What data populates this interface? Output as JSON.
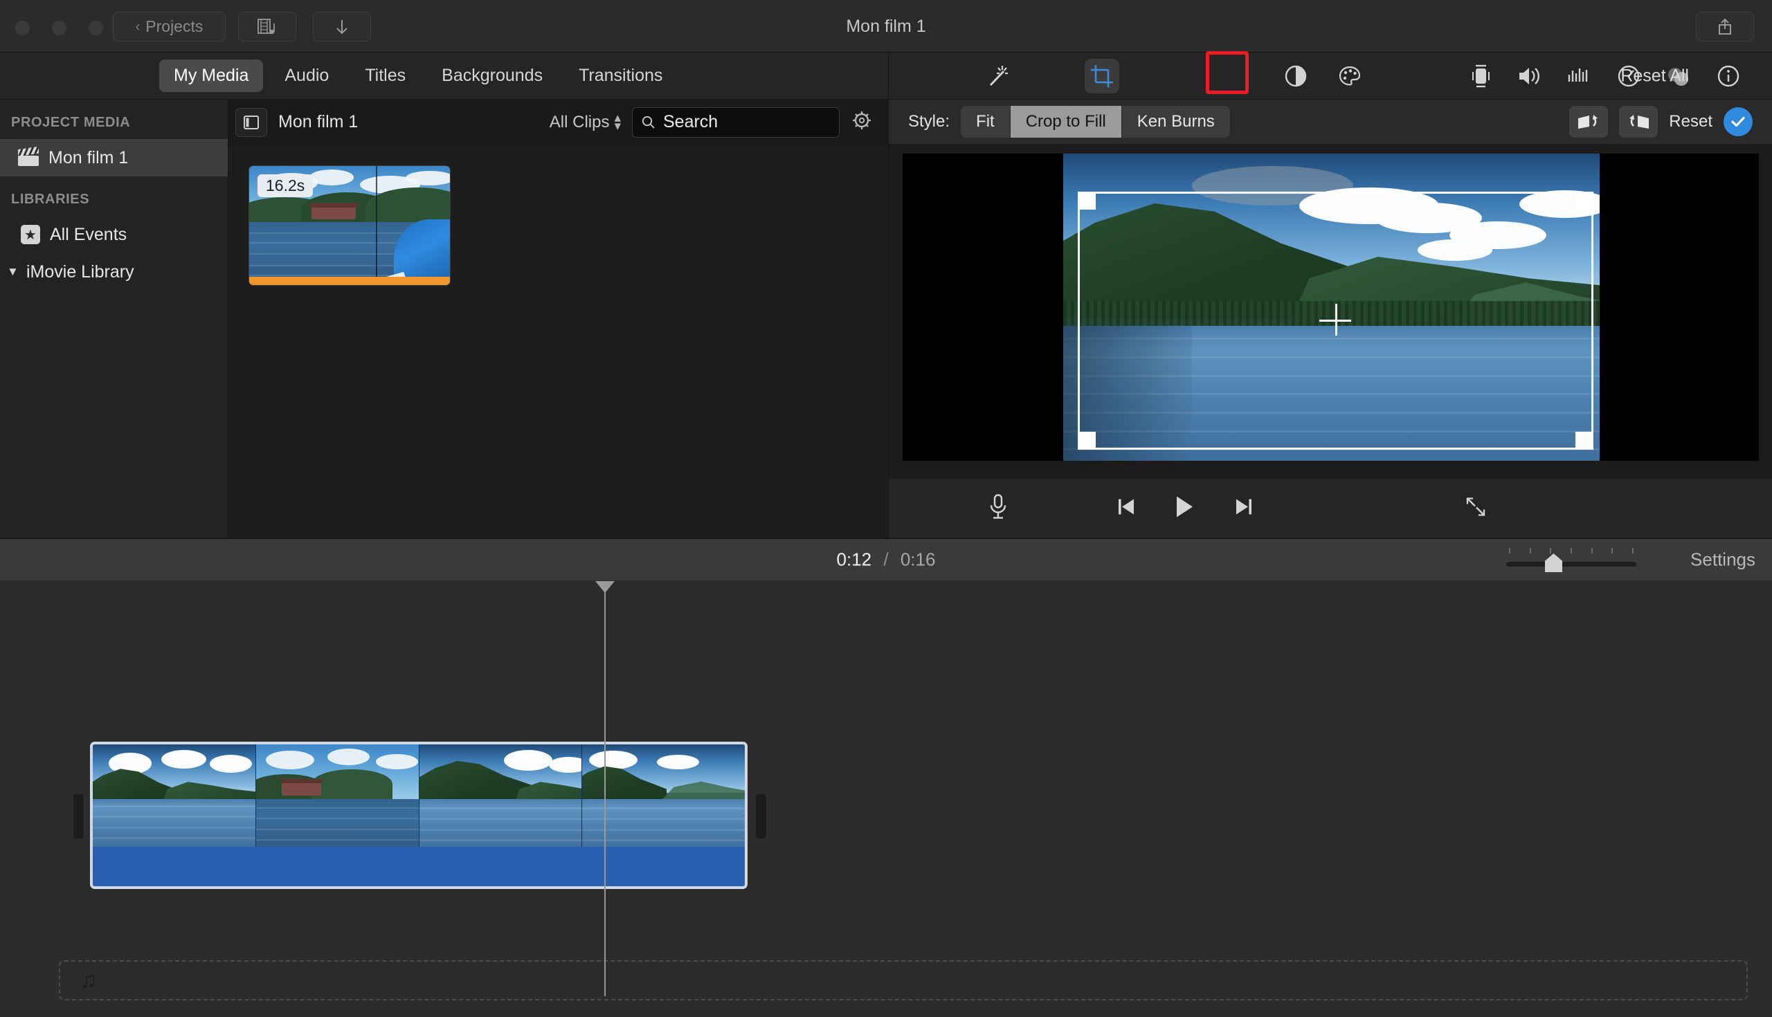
{
  "window": {
    "title": "Mon film 1",
    "traffic_lights": [
      "close",
      "minimize",
      "zoom"
    ],
    "projects_button": "Projects",
    "media_button_icon": "film-music-icon",
    "import_button_icon": "download-arrow-icon",
    "share_button_icon": "share-icon"
  },
  "tabs": [
    {
      "label": "My Media",
      "active": true
    },
    {
      "label": "Audio",
      "active": false
    },
    {
      "label": "Titles",
      "active": false
    },
    {
      "label": "Backgrounds",
      "active": false
    },
    {
      "label": "Transitions",
      "active": false
    }
  ],
  "sidebar": {
    "project_media_header": "PROJECT MEDIA",
    "project_item": {
      "label": "Mon film 1",
      "icon": "clapperboard-icon",
      "selected": true
    },
    "libraries_header": "LIBRARIES",
    "all_events": {
      "label": "All Events",
      "icon": "star-icon"
    },
    "imovie_library": {
      "label": "iMovie Library",
      "icon": "disclosure-triangle-icon",
      "expanded": true
    }
  },
  "browser": {
    "panel_toggle_icon": "sidebar-toggle-icon",
    "title": "Mon film 1",
    "filter_label": "All Clips",
    "filter_icon": "up-down-chevron-icon",
    "search_placeholder": "Search",
    "search_icon": "search-icon",
    "settings_icon": "gear-icon",
    "clips": [
      {
        "duration": "16.2s",
        "selected": true
      }
    ]
  },
  "inspector": {
    "tools": [
      {
        "name": "magic-wand-icon",
        "active": false
      },
      {
        "name": "color-balance-icon",
        "active": false
      },
      {
        "name": "color-correction-icon",
        "active": false
      },
      {
        "name": "crop-icon",
        "active": true,
        "highlighted": true
      },
      {
        "name": "stabilization-icon",
        "active": false
      },
      {
        "name": "volume-icon",
        "active": false
      },
      {
        "name": "noise-reduction-icon",
        "active": false
      },
      {
        "name": "speed-icon",
        "active": false
      },
      {
        "name": "filter-icon",
        "active": false
      },
      {
        "name": "info-icon",
        "active": false
      }
    ],
    "reset_all_label": "Reset All",
    "highlight_color": "#ee1c25",
    "active_tool_color": "#3d8ce0"
  },
  "style_bar": {
    "label": "Style:",
    "options": [
      {
        "label": "Fit",
        "selected": false
      },
      {
        "label": "Crop to Fill",
        "selected": true
      },
      {
        "label": "Ken Burns",
        "selected": false
      }
    ],
    "rotate_ccw_icon": "rotate-counterclockwise-icon",
    "rotate_cw_icon": "rotate-clockwise-icon",
    "reset_label": "Reset",
    "apply_icon": "checkmark-icon",
    "apply_color": "#2f8ae0"
  },
  "viewer": {
    "crop_overlay": true,
    "cursor_icon": "crosshair-cursor",
    "controls": [
      {
        "name": "voiceover-icon",
        "label": "microphone"
      },
      {
        "name": "skip-to-start-icon",
        "label": "previous"
      },
      {
        "name": "play-icon",
        "label": "play"
      },
      {
        "name": "skip-to-end-icon",
        "label": "next"
      },
      {
        "name": "fullscreen-icon",
        "label": "full screen"
      }
    ]
  },
  "timeline": {
    "current_time": "0:12",
    "separator": "/",
    "total_time": "0:16",
    "settings_label": "Settings",
    "zoom_slider_value": 30,
    "clip": {
      "selected": true
    },
    "music_drop_icon": "music-note-icon"
  }
}
